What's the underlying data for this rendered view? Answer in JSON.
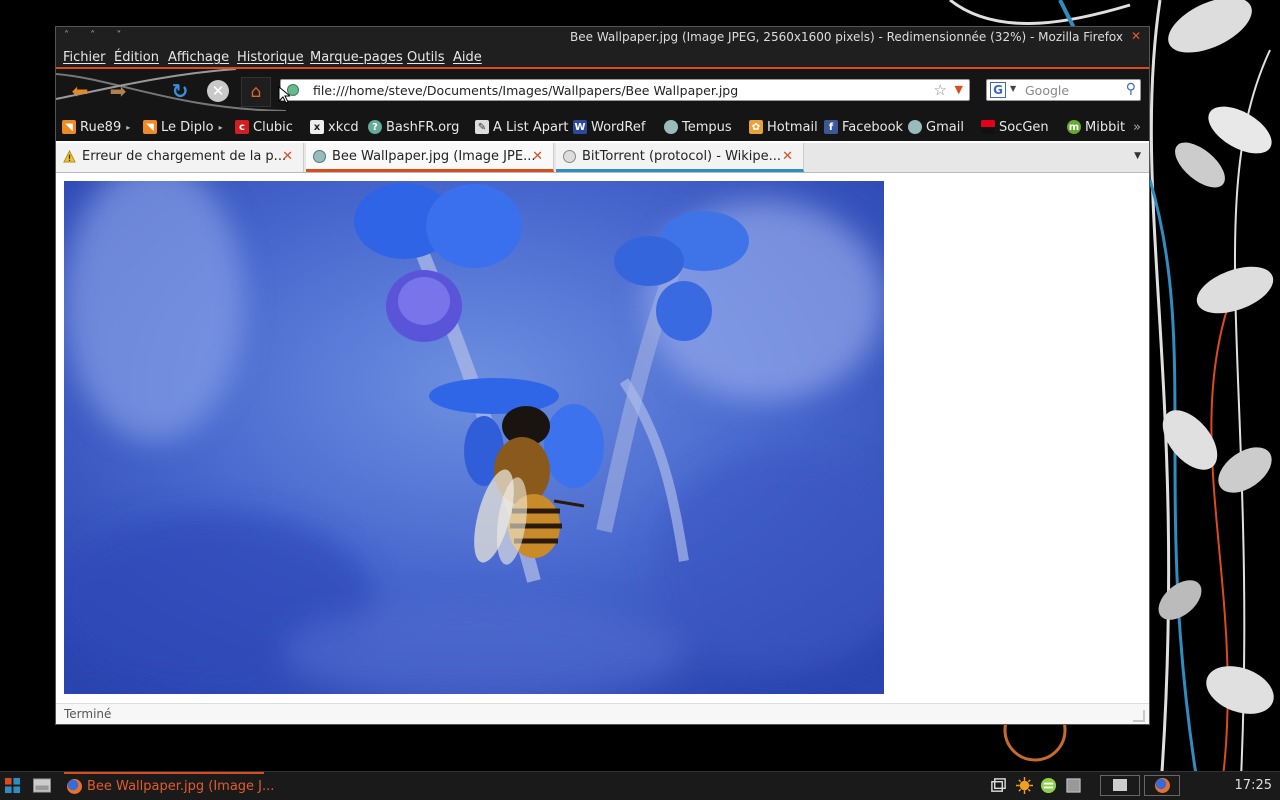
{
  "window": {
    "title": "Bee Wallpaper.jpg (Image JPEG, 2560x1600 pixels) - Redimensionnée (32%) - Mozilla Firefox",
    "controls": "˄ ˄ ˅",
    "close": "✕"
  },
  "menu": [
    "Fichier",
    "Édition",
    "Affichage",
    "Historique",
    "Marque-pages",
    "Outils",
    "Aide"
  ],
  "navbar": {
    "url": "file:///home/steve/Documents/Images/Wallpapers/Bee Wallpaper.jpg",
    "search_placeholder": "Google"
  },
  "bookmarks": [
    "Rue89",
    "Le Diplo",
    "Clubic",
    "xkcd",
    "BashFR.org",
    "A List Apart",
    "WordRef",
    "Tempus",
    "Hotmail",
    "Facebook",
    "Gmail",
    "SocGen",
    "Mibbit"
  ],
  "tabs": [
    {
      "label": "Erreur de chargement de la p..."
    },
    {
      "label": "Bee Wallpaper.jpg (Image JPE..."
    },
    {
      "label": "BitTorrent (protocol) - Wikipe..."
    }
  ],
  "status": "Terminé",
  "taskbar": {
    "task_label": "Bee Wallpaper.jpg (Image J...",
    "clock": "17:25"
  },
  "colors": {
    "accent": "#d94c1e",
    "tab_blue": "#2f8dc0"
  }
}
